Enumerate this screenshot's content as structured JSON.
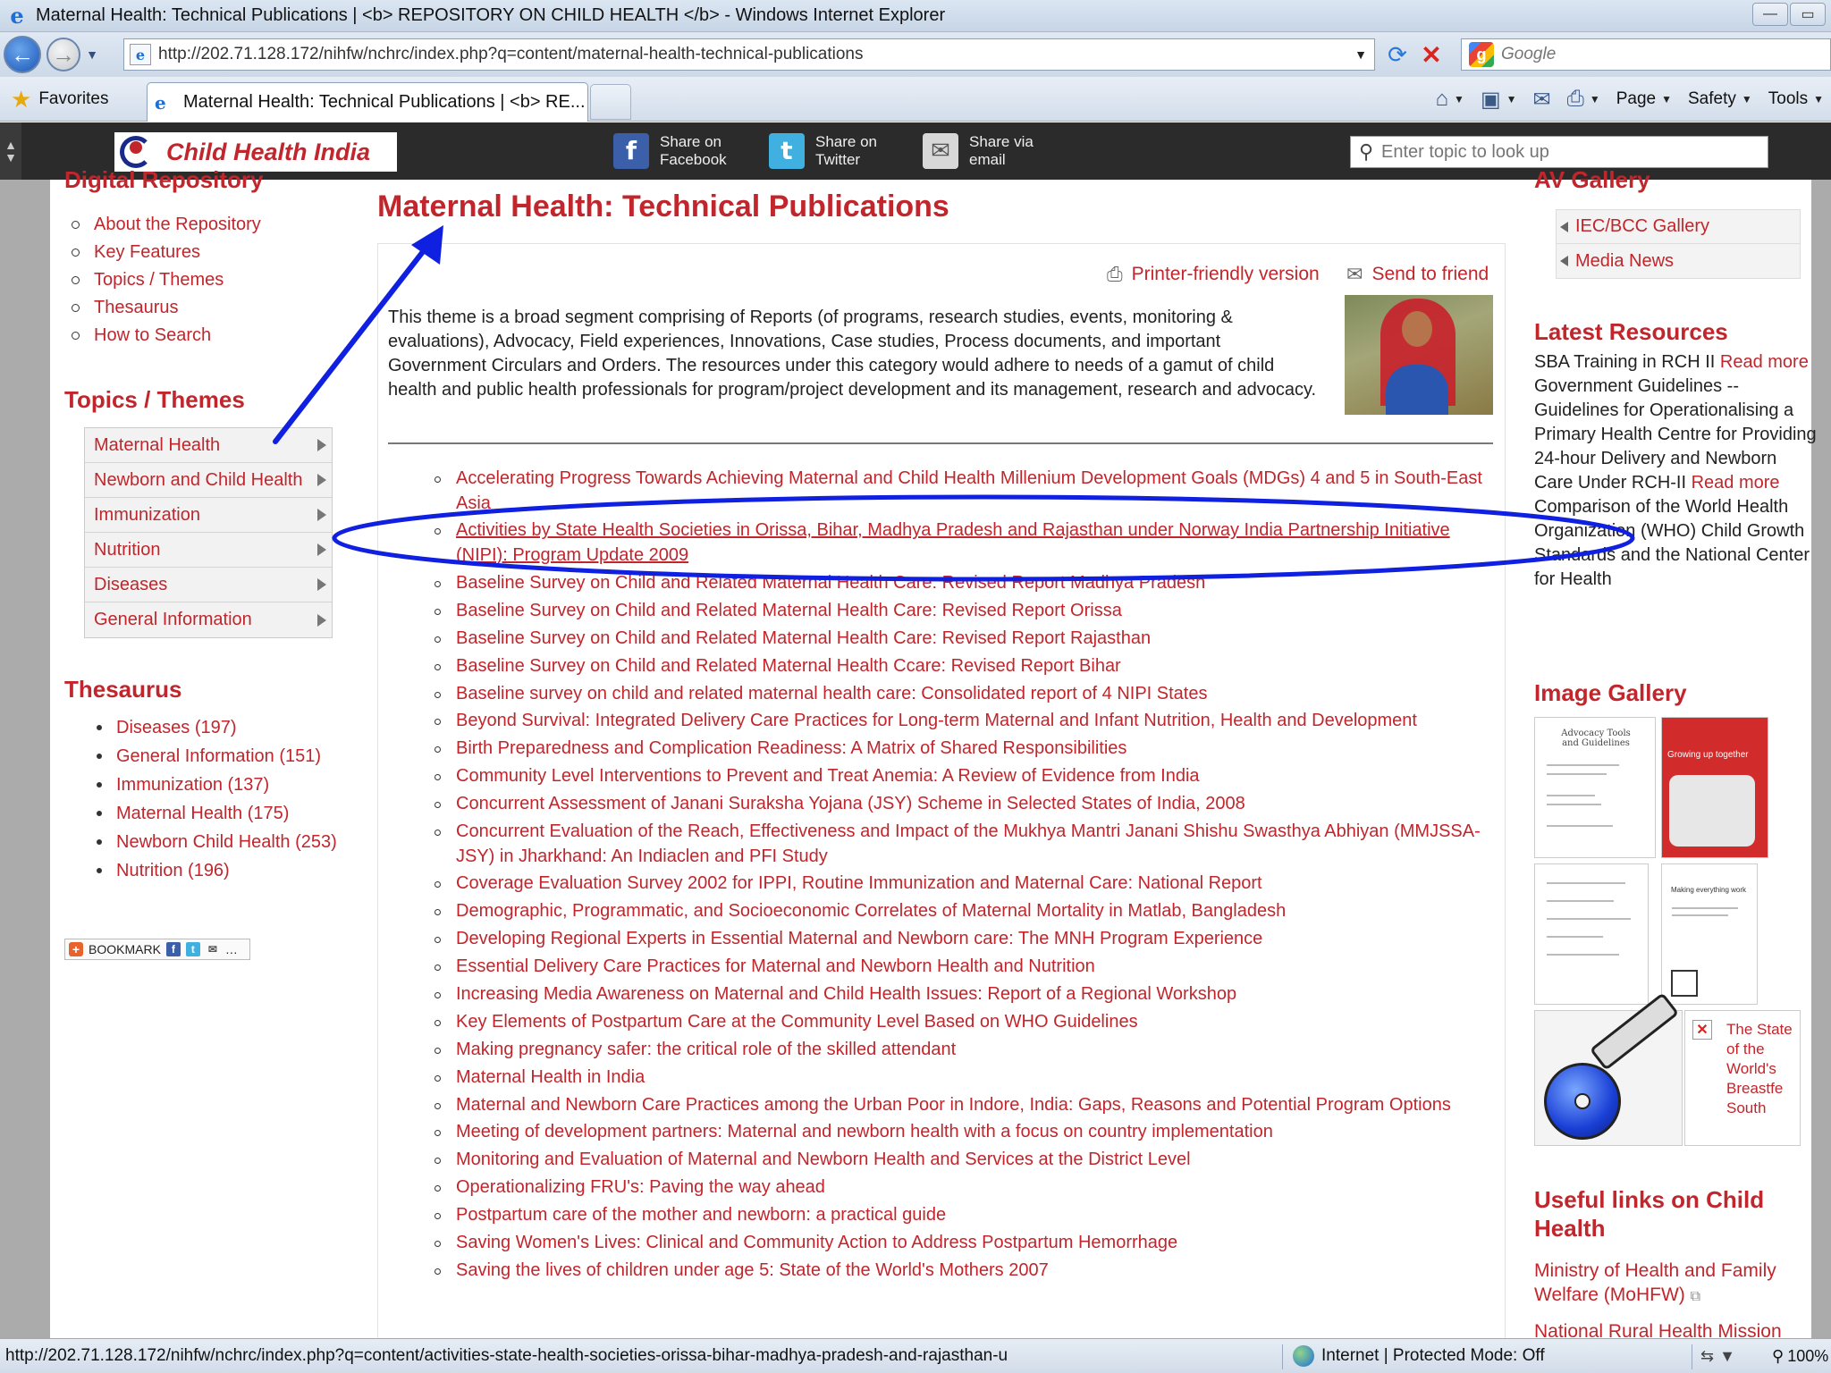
{
  "browser": {
    "window_title": "Maternal Health: Technical Publications | <b> REPOSITORY ON CHILD HEALTH </b> - Windows Internet Explorer",
    "url": "http://202.71.128.172/nihfw/nchrc/index.php?q=content/maternal-health-technical-publications",
    "search_placeholder": "Google",
    "favorites_label": "Favorites",
    "tab_title": "Maternal Health: Technical Publications | <b> RE...",
    "commands": {
      "page": "Page",
      "safety": "Safety",
      "tools": "Tools"
    },
    "status_url": "http://202.71.128.172/nihfw/nchrc/index.php?q=content/activities-state-health-societies-orissa-bihar-madhya-pradesh-and-rajasthan-u",
    "status_zone": "Internet | Protected Mode: Off",
    "zoom": "100%"
  },
  "site": {
    "logo_text": "Child Health India",
    "share": [
      {
        "line1": "Share on",
        "line2": "Facebook"
      },
      {
        "line1": "Share on",
        "line2": "Twitter"
      },
      {
        "line1": "Share via",
        "line2": "email"
      }
    ],
    "search_placeholder": "Enter topic to look up"
  },
  "left_sidebar": {
    "digital_repository_title": "Digital Repository",
    "repo_links": [
      "About the Repository",
      "Key Features",
      "Topics / Themes",
      "Thesaurus",
      "How to Search"
    ],
    "topics_title": "Topics / Themes",
    "topics": [
      "Maternal Health",
      "Newborn and Child Health",
      "Immunization",
      "Nutrition",
      "Diseases",
      "General Information"
    ],
    "thesaurus_title": "Thesaurus",
    "thesaurus": [
      "Diseases (197)",
      "General Information (151)",
      "Immunization (137)",
      "Maternal Health (175)",
      "Newborn Child Health (253)",
      "Nutrition (196)"
    ],
    "bookmark_label": "BOOKMARK"
  },
  "main": {
    "title": "Maternal Health: Technical Publications",
    "printer_link": "Printer-friendly version",
    "send_link": "Send to friend",
    "intro": "This theme is a broad segment comprising of Reports (of programs, research studies, events, monitoring & evaluations), Advocacy, Field experiences, Innovations, Case studies, Process documents, and important Government Circulars and Orders. The resources under this category would adhere to needs of a gamut of child health and public health professionals for program/project development and its management, research and advocacy.",
    "publications": [
      "Accelerating Progress Towards Achieving Maternal and Child Health Millenium Development Goals (MDGs) 4 and 5 in South-East Asia",
      "Activities by State Health Societies in Orissa, Bihar, Madhya Pradesh and Rajasthan under Norway India Partnership Initiative (NIPI): Program Update 2009",
      "Baseline Survey on Child and Related Maternal Health Care: Revised Report Madhya Pradesh",
      "Baseline Survey on Child and Related Maternal Health Care: Revised Report Orissa",
      "Baseline Survey on Child and Related Maternal Health Care: Revised Report Rajasthan",
      "Baseline Survey on Child and Related Maternal Health Ccare: Revised Report Bihar",
      "Baseline survey on child and related maternal health care: Consolidated report of 4 NIPI States",
      "Beyond Survival: Integrated Delivery Care Practices for Long-term Maternal and Infant Nutrition, Health and Development",
      "Birth Preparedness and Complication Readiness: A Matrix of Shared Responsibilities",
      "Community Level Interventions to Prevent and Treat Anemia: A Review of Evidence from India",
      "Concurrent Assessment of Janani Suraksha Yojana (JSY) Scheme in Selected States of India, 2008",
      "Concurrent Evaluation of the Reach, Effectiveness and Impact of the Mukhya Mantri Janani Shishu Swasthya Abhiyan (MMJSSA-JSY) in Jharkhand: An Indiaclen and PFI Study",
      "Coverage Evaluation Survey 2002 for IPPI, Routine Immunization and Maternal Care: National Report",
      "Demographic, Programmatic, and Socioeconomic Correlates of Maternal Mortality in Matlab, Bangladesh",
      "Developing Regional Experts in Essential Maternal and Newborn care: The MNH Program Experience",
      "Essential Delivery Care Practices for Maternal and Newborn Health and Nutrition",
      "Increasing Media Awareness on Maternal and Child Health Issues: Report of a Regional Workshop",
      "Key Elements of Postpartum Care at the Community Level Based on WHO Guidelines",
      "Making pregnancy safer: the critical role of the skilled attendant",
      "Maternal Health in India",
      "Maternal and Newborn Care Practices among the Urban Poor in Indore, India: Gaps, Reasons and Potential Program Options",
      "Meeting of development partners: Maternal and newborn health with a focus on country implementation",
      "Monitoring and Evaluation of Maternal and Newborn Health and Services at the District Level",
      "Operationalizing FRU's: Paving the way ahead",
      "Postpartum care of the mother and newborn: a practical guide",
      "Saving Women's Lives: Clinical and Community Action to Address Postpartum Hemorrhage",
      "Saving the lives of children under age 5: State of the World's Mothers 2007"
    ]
  },
  "right_sidebar": {
    "av_title": "AV Gallery",
    "av_items": [
      "IEC/BCC Gallery",
      "Media News"
    ],
    "latest_title": "Latest Resources",
    "latest": [
      {
        "text": "SBA Training in RCH II ",
        "more": "Read more"
      },
      {
        "text": "Government Guidelines -- Guidelines for Operationalising a Primary Health Centre for Providing 24-hour Delivery and Newborn Care Under RCH-II ",
        "more": "Read more"
      },
      {
        "text": "Comparison of the World Health Organization (WHO) Child Growth Standards and the National Center for Health",
        "more": ""
      }
    ],
    "image_gallery_title": "Image Gallery",
    "thumb_captions": [
      "Advocacy Tools and Guidelines",
      "Growing up together",
      "",
      "Making everything work"
    ],
    "broken_image_alt": "The State of the World's Breastfe South",
    "useful_title": "Useful links on Child Health",
    "useful_links": [
      "Ministry of Health and Family Welfare (MoHFW)",
      "National Rural Health Mission"
    ]
  },
  "colors": {
    "link_red": "#c0262c",
    "annotation_blue": "#1020e0",
    "header_dark": "#2b2b2b"
  }
}
